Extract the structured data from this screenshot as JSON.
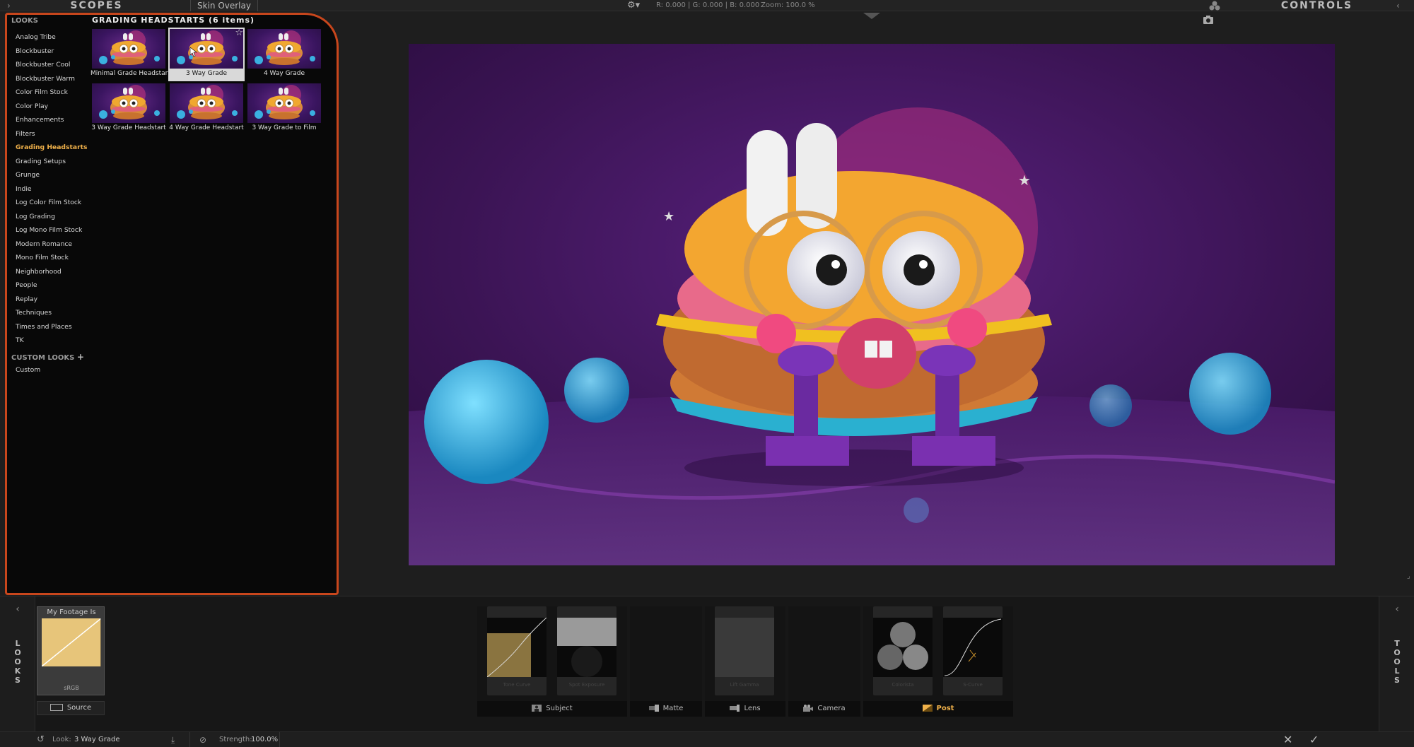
{
  "topbar": {
    "scopes_title": "SCOPES",
    "skin_overlay_label": "Skin Overlay",
    "rgb_readout": "R: 0.000 | G: 0.000 | B: 0.000",
    "zoom_readout": "Zoom: 100.0 %",
    "controls_title": "CONTROLS"
  },
  "looks_panel": {
    "header": "LOOKS",
    "categories": [
      "Analog Tribe",
      "Blockbuster",
      "Blockbuster Cool",
      "Blockbuster Warm",
      "Color Film Stock",
      "Color Play",
      "Enhancements",
      "Filters",
      "Grading Headstarts",
      "Grading Setups",
      "Grunge",
      "Indie",
      "Log Color Film Stock",
      "Log Grading",
      "Log Mono Film Stock",
      "Modern Romance",
      "Mono Film Stock",
      "Neighborhood",
      "People",
      "Replay",
      "Techniques",
      "Times and Places",
      "TK"
    ],
    "active_category": "Grading Headstarts",
    "custom_header": "CUSTOM LOOKS",
    "custom_plus": "+",
    "custom_items": [
      "Custom"
    ],
    "grid_title": "GRADING HEADSTARTS (6 items)",
    "thumbnails": [
      {
        "label": "Minimal Grade Headstart"
      },
      {
        "label": "3 Way Grade"
      },
      {
        "label": "4 Way Grade"
      },
      {
        "label": "3 Way Grade Headstart"
      },
      {
        "label": "4 Way Grade Headstart"
      },
      {
        "label": "3 Way Grade to Film"
      }
    ],
    "selected_thumbnail": "3 Way Grade"
  },
  "bottom": {
    "left_side_letters": "L\nO\nO\nK\nS",
    "right_side_letters": "T\nO\nO\nL\nS",
    "source_title": "My Footage Is",
    "source_footer": "sRGB",
    "source_button": "Source",
    "tool_tabs": [
      "Subject",
      "Matte",
      "Lens",
      "Camera",
      "Post"
    ],
    "active_tab": "Post",
    "card_labels": [
      "Tone Curve",
      "Spot Exposure",
      "Lift Gamma",
      "Colorista",
      "S-Curve"
    ]
  },
  "status": {
    "look_label": "Look:",
    "look_value": "3 Way Grade",
    "strength_label": "Strength:",
    "strength_value": "100.0%"
  },
  "colors": {
    "accent_orange": "#c8461c",
    "active_yellow": "#f0b14a",
    "image_purple": "#3b1454"
  }
}
